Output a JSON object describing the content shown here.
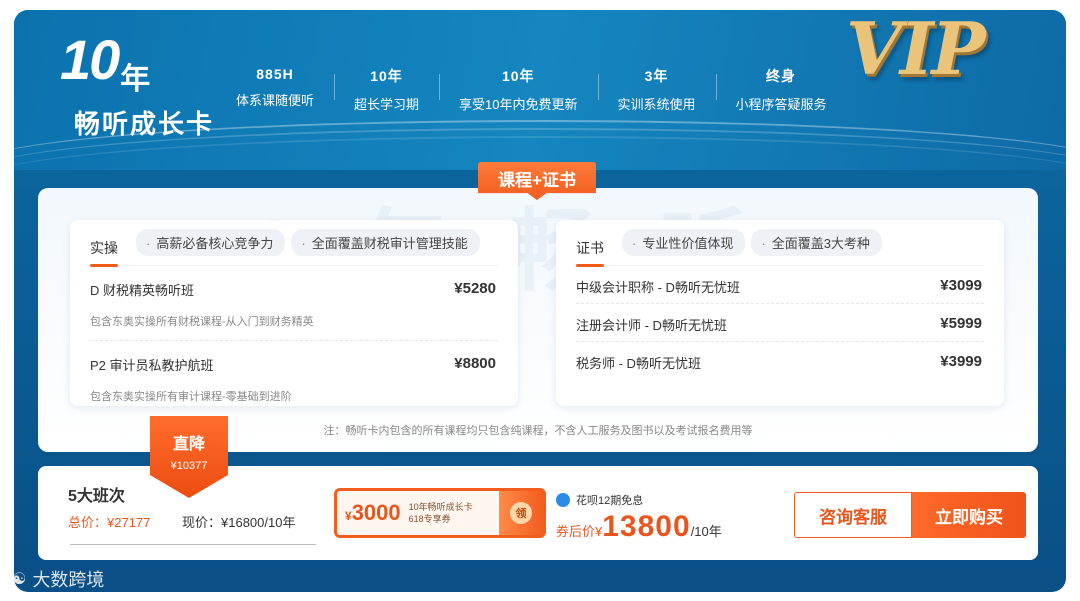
{
  "brand": {
    "big": "10",
    "year": "年",
    "subtitle": "畅听成长卡",
    "vip": "VIP"
  },
  "features": [
    {
      "value": "885H",
      "label": "体系课随便听"
    },
    {
      "value": "10年",
      "label": "超长学习期"
    },
    {
      "value": "10年",
      "label": "享受10年内免费更新"
    },
    {
      "value": "3年",
      "label": "实训系统使用"
    },
    {
      "value": "终身",
      "label": "小程序答疑服务"
    }
  ],
  "ribbon": "课程+证书",
  "watermark_text": "10年畅听",
  "practice": {
    "tab": "实操",
    "chips": [
      "高薪必备核心竞争力",
      "全面覆盖财税审计管理技能"
    ],
    "items": [
      {
        "name": "D 财税精英畅听班",
        "price": "¥5280",
        "desc": "包含东奥实操所有财税课程-从入门到财务精英"
      },
      {
        "name": "P2 审计员私教护航班",
        "price": "¥8800",
        "desc": "包含东奥实操所有审计课程-零基础到进阶"
      }
    ]
  },
  "certificate": {
    "tab": "证书",
    "chips": [
      "专业性价值体现",
      "全面覆盖3大考种"
    ],
    "items": [
      {
        "name": "中级会计职称 - D畅听无忧班",
        "price": "¥3099"
      },
      {
        "name": "注册会计师 - D畅听无忧班",
        "price": "¥5999"
      },
      {
        "name": "税务师 - D畅听无忧班",
        "price": "¥3999"
      }
    ]
  },
  "note": "注：畅听卡内包含的所有课程均只包含纯课程，不含人工服务及图书以及考试报名费用等",
  "drop": {
    "title": "直降",
    "amount": "¥10377"
  },
  "bottom": {
    "title": "5大班次",
    "total_label": "总价：¥27177",
    "current_label": "现价：¥16800/10年",
    "coupon": {
      "currency": "¥",
      "amount": "3000",
      "line1": "10年畅听成长卡",
      "line2": "618专享券",
      "claim": "领"
    },
    "huabei": "花呗12期免息",
    "final_label": "券后价",
    "final_currency": "¥",
    "final_price": "13800",
    "final_unit": "/10年",
    "consult_btn": "咨询客服",
    "buy_btn": "立即购买"
  },
  "logo_watermark": "大数跨境",
  "colors": {
    "accent": "#f25d1e",
    "header_blue": "#0d6da6",
    "panel_bg": "#f2f8fd"
  }
}
